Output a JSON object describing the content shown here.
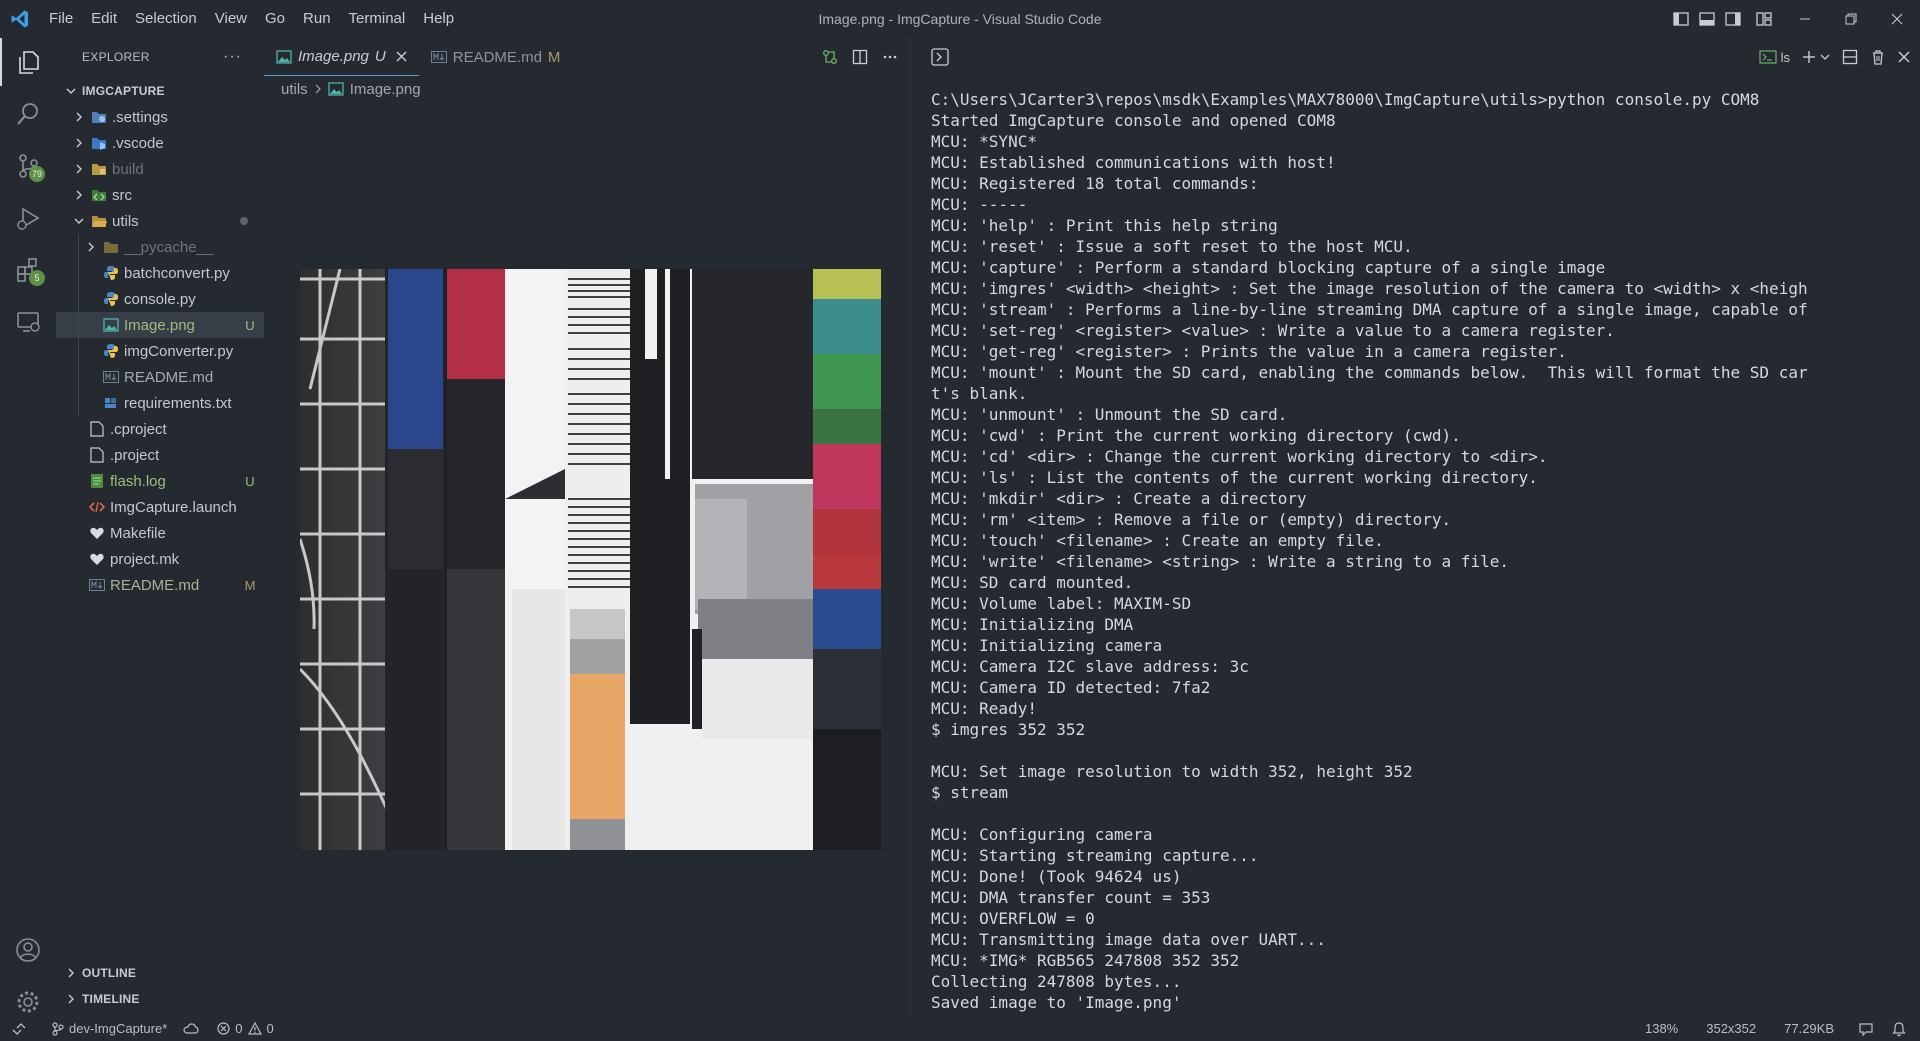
{
  "titlebar": {
    "menu": [
      "File",
      "Edit",
      "Selection",
      "View",
      "Go",
      "Run",
      "Terminal",
      "Help"
    ],
    "window_title": "Image.png - ImgCapture - Visual Studio Code"
  },
  "activity": {
    "scm_badge": "79",
    "extensions_badge": "5"
  },
  "sidebar": {
    "title": "EXPLORER",
    "more": "···",
    "root": "IMGCAPTURE",
    "items": [
      {
        "label": ".settings",
        "status": ""
      },
      {
        "label": ".vscode",
        "status": ""
      },
      {
        "label": "build",
        "status": ""
      },
      {
        "label": "src",
        "status": ""
      },
      {
        "label": "utils",
        "status": ""
      },
      {
        "label": "__pycache__",
        "status": ""
      },
      {
        "label": "batchconvert.py",
        "status": ""
      },
      {
        "label": "console.py",
        "status": ""
      },
      {
        "label": "Image.png",
        "status": "U"
      },
      {
        "label": "imgConverter.py",
        "status": ""
      },
      {
        "label": "README.md",
        "status": ""
      },
      {
        "label": "requirements.txt",
        "status": ""
      },
      {
        "label": ".cproject",
        "status": ""
      },
      {
        "label": ".project",
        "status": ""
      },
      {
        "label": "flash.log",
        "status": "U"
      },
      {
        "label": "ImgCapture.launch",
        "status": ""
      },
      {
        "label": "Makefile",
        "status": ""
      },
      {
        "label": "project.mk",
        "status": ""
      },
      {
        "label": "README.md",
        "status": "M"
      }
    ],
    "outline": "OUTLINE",
    "timeline": "TIMELINE"
  },
  "editor": {
    "tabs": [
      {
        "label": "Image.png",
        "status": "U"
      },
      {
        "label": "README.md",
        "status": "M"
      }
    ],
    "breadcrumb": [
      "utils",
      "Image.png"
    ]
  },
  "terminal": {
    "shell_label": "ls",
    "lines": [
      "C:\\Users\\JCarter3\\repos\\msdk\\Examples\\MAX78000\\ImgCapture\\utils>python console.py COM8",
      "Started ImgCapture console and opened COM8",
      "MCU: *SYNC*",
      "MCU: Established communications with host!",
      "MCU: Registered 18 total commands:",
      "MCU: -----",
      "MCU: 'help' : Print this help string",
      "MCU: 'reset' : Issue a soft reset to the host MCU.",
      "MCU: 'capture' : Perform a standard blocking capture of a single image",
      "MCU: 'imgres' <width> <height> : Set the image resolution of the camera to <width> x <heigh",
      "MCU: 'stream' : Performs a line-by-line streaming DMA capture of a single image, capable of",
      "MCU: 'set-reg' <register> <value> : Write a value to a camera register.",
      "MCU: 'get-reg' <register> : Prints the value in a camera register.",
      "MCU: 'mount' : Mount the SD card, enabling the commands below.  This will format the SD car",
      "t's blank.",
      "MCU: 'unmount' : Unmount the SD card.",
      "MCU: 'cwd' : Print the current working directory (cwd).",
      "MCU: 'cd' <dir> : Change the current working directory to <dir>.",
      "MCU: 'ls' : List the contents of the current working directory.",
      "MCU: 'mkdir' <dir> : Create a directory",
      "MCU: 'rm' <item> : Remove a file or (empty) directory.",
      "MCU: 'touch' <filename> : Create an empty file.",
      "MCU: 'write' <filename> <string> : Write a string to a file.",
      "MCU: SD card mounted.",
      "MCU: Volume label: MAXIM-SD",
      "MCU: Initializing DMA",
      "MCU: Initializing camera",
      "MCU: Camera I2C slave address: 3c",
      "MCU: Camera ID detected: 7fa2",
      "MCU: Ready!",
      "$ imgres 352 352",
      "",
      "MCU: Set image resolution to width 352, height 352",
      "$ stream",
      "",
      "MCU: Configuring camera",
      "MCU: Starting streaming capture...",
      "MCU: Done! (Took 94624 us)",
      "MCU: DMA transfer count = 353",
      "MCU: OVERFLOW = 0",
      "MCU: Transmitting image data over UART...",
      "MCU: *IMG* RGB565 247808 352 352",
      "Collecting 247808 bytes...",
      "Saved image to 'Image.png'"
    ]
  },
  "statusbar": {
    "branch": "dev-ImgCapture*",
    "errors": "0",
    "warnings": "0",
    "zoom": "138%",
    "dimensions": "352x352",
    "size": "77.29KB"
  }
}
